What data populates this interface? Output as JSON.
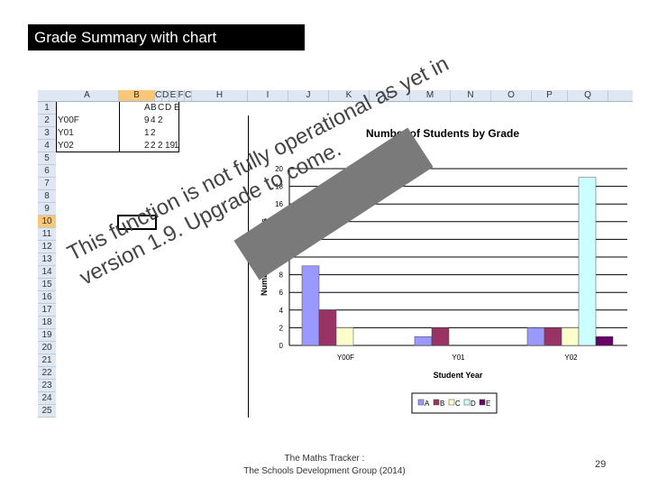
{
  "slide": {
    "title": "Grade Summary with chart",
    "footer_line1": "The Maths Tracker :",
    "footer_line2": "The Schools Development Group (2014)",
    "page_number": "29"
  },
  "sheet": {
    "columns": [
      "A",
      "B",
      "C",
      "D",
      "E",
      "F",
      "C",
      "H",
      "I",
      "J",
      "K",
      "L",
      "M",
      "N",
      "O",
      "P",
      "Q"
    ],
    "rows": [
      [
        "",
        "A",
        "B",
        "C",
        "D",
        "E"
      ],
      [
        "Y00F",
        "9",
        "4",
        "2",
        "",
        ""
      ],
      [
        "Y01",
        "1",
        "2",
        "",
        "",
        ""
      ],
      [
        "Y02",
        "2",
        "2",
        "2",
        "19",
        "1"
      ]
    ],
    "row_count": 25
  },
  "overlay": {
    "line1": "This function is not fully operational as yet in",
    "line2": "version 1.9. Upgrade to come."
  },
  "chart_data": {
    "type": "bar",
    "title": "Number of Students by Grade",
    "xlabel": "Student Year",
    "ylabel": "Number of Students",
    "categories": [
      "Y00F",
      "Y01",
      "Y02"
    ],
    "ylim": [
      0,
      20
    ],
    "yticks": [
      0,
      2,
      4,
      6,
      8,
      10,
      12,
      14,
      16,
      18,
      20
    ],
    "grid": true,
    "legend": "bottom",
    "series": [
      {
        "name": "A",
        "values": [
          9,
          1,
          2
        ],
        "color": "#9999ff"
      },
      {
        "name": "B",
        "values": [
          4,
          2,
          2
        ],
        "color": "#993366"
      },
      {
        "name": "C",
        "values": [
          2,
          0,
          2
        ],
        "color": "#ffffcc"
      },
      {
        "name": "D",
        "values": [
          0,
          0,
          19
        ],
        "color": "#ccffff"
      },
      {
        "name": "E",
        "values": [
          0,
          0,
          1
        ],
        "color": "#660066"
      }
    ]
  }
}
